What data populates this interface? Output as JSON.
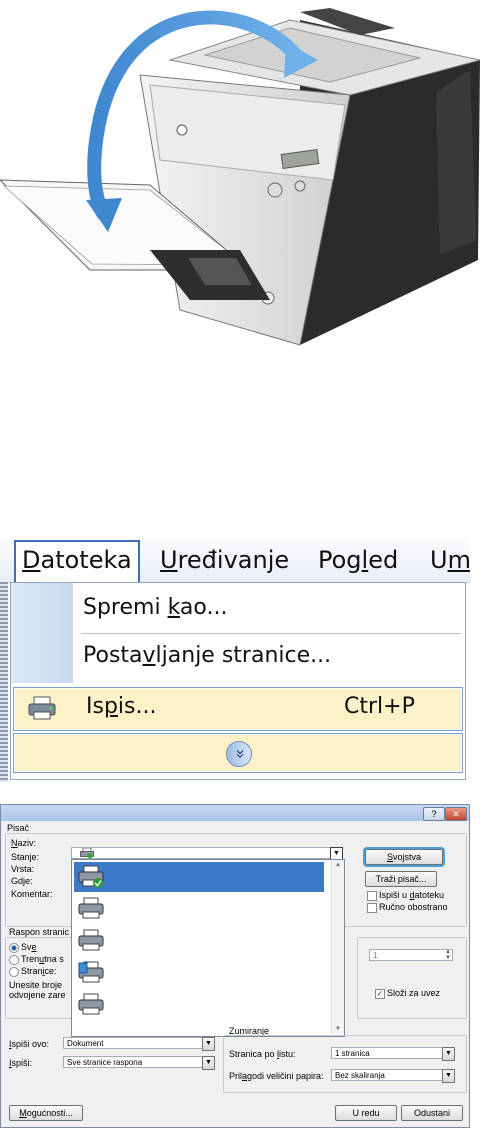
{
  "menu": {
    "items": [
      {
        "pre": "",
        "ul": "D",
        "post": "atoteka"
      },
      {
        "pre": "",
        "ul": "U",
        "post": "ređivanje"
      },
      {
        "pre": "Pog",
        "ul": "l",
        "post": "ed"
      },
      {
        "pre": "U",
        "ul": "m",
        "post": ""
      }
    ],
    "dropdown": {
      "save_as": {
        "pre": "Spremi ",
        "ul": "k",
        "post": "ao..."
      },
      "page_setup": {
        "pre": "Posta",
        "ul": "v",
        "post": "ljanje stranice..."
      },
      "print": {
        "pre": "Is",
        "ul": "p",
        "post": "is..."
      },
      "print_shortcut": "Ctrl+P",
      "expand_glyph": "»"
    }
  },
  "dialog": {
    "help_glyph": "?",
    "close_glyph": "✕",
    "printer_group": "Pisač",
    "fields": {
      "name": {
        "pre": "",
        "ul": "N",
        "post": "aziv:"
      },
      "status": "Stanje:",
      "type": "Vrsta:",
      "where": "Gdje:",
      "comment": "Komentar:"
    },
    "properties_button": {
      "pre": "",
      "ul": "S",
      "post": "vojstva"
    },
    "find_printer_button": "Traži pisač...",
    "print_to_file": {
      "pre": "Ispiši u ",
      "ul": "d",
      "post": "atoteku"
    },
    "manual_duplex": "Ručno obostrano",
    "range_group": "Raspon stranic",
    "range_all": {
      "pre": "Sv",
      "ul": "e",
      "post": ""
    },
    "range_current": {
      "pre": "Tren",
      "ul": "u",
      "post": "tna s"
    },
    "range_pages": {
      "pre": "Stran",
      "ul": "i",
      "post": "ce:"
    },
    "range_hint_1": "Unesite broje",
    "range_hint_2": "odvojene zare",
    "copies_value": "1",
    "collate": "Složi za uvez",
    "print_what_label": {
      "pre": "",
      "ul": "I",
      "post": "spiši ovo:"
    },
    "print_what_value": "Dokument",
    "print_label": {
      "pre": "",
      "ul": "I",
      "post": "spiši:"
    },
    "print_value": "Sve stranice raspona",
    "zoom_group": "Zumiranje",
    "pages_per_sheet_label": {
      "pre": "Stranica po ",
      "ul": "l",
      "post": "istu:"
    },
    "pages_per_sheet_value": "1 stranica",
    "scale_label": {
      "pre": "Pril",
      "ul": "a",
      "post": "godi veličini papira:"
    },
    "scale_value": "Bez skaliranja",
    "options_button": {
      "pre": "",
      "ul": "M",
      "post": "ogućnosti..."
    },
    "ok_button": "U redu",
    "cancel_button": "Odustani"
  }
}
